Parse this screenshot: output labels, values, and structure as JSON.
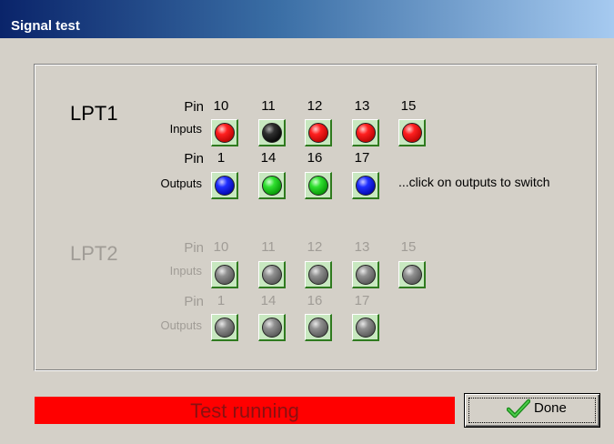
{
  "window": {
    "title": "Signal test"
  },
  "hint": "...click on outputs to switch",
  "status": {
    "text": "Test running",
    "color": "#ff0000"
  },
  "done_button": {
    "label": "Done",
    "icon": "checkmark-icon"
  },
  "ports": {
    "lpt1": {
      "label": "LPT1",
      "enabled": true,
      "pin_label": "Pin",
      "inputs_label": "Inputs",
      "outputs_label": "Outputs",
      "inputs": [
        {
          "pin": "10",
          "state": "red"
        },
        {
          "pin": "11",
          "state": "black"
        },
        {
          "pin": "12",
          "state": "red"
        },
        {
          "pin": "13",
          "state": "red"
        },
        {
          "pin": "15",
          "state": "red"
        }
      ],
      "outputs": [
        {
          "pin": "1",
          "state": "blue"
        },
        {
          "pin": "14",
          "state": "green"
        },
        {
          "pin": "16",
          "state": "green"
        },
        {
          "pin": "17",
          "state": "blue"
        }
      ]
    },
    "lpt2": {
      "label": "LPT2",
      "enabled": false,
      "pin_label": "Pin",
      "inputs_label": "Inputs",
      "outputs_label": "Outputs",
      "inputs": [
        {
          "pin": "10",
          "state": "gray"
        },
        {
          "pin": "11",
          "state": "gray"
        },
        {
          "pin": "12",
          "state": "gray"
        },
        {
          "pin": "13",
          "state": "gray"
        },
        {
          "pin": "15",
          "state": "gray"
        }
      ],
      "outputs": [
        {
          "pin": "1",
          "state": "gray"
        },
        {
          "pin": "14",
          "state": "gray"
        },
        {
          "pin": "16",
          "state": "gray"
        },
        {
          "pin": "17",
          "state": "gray"
        }
      ]
    }
  }
}
